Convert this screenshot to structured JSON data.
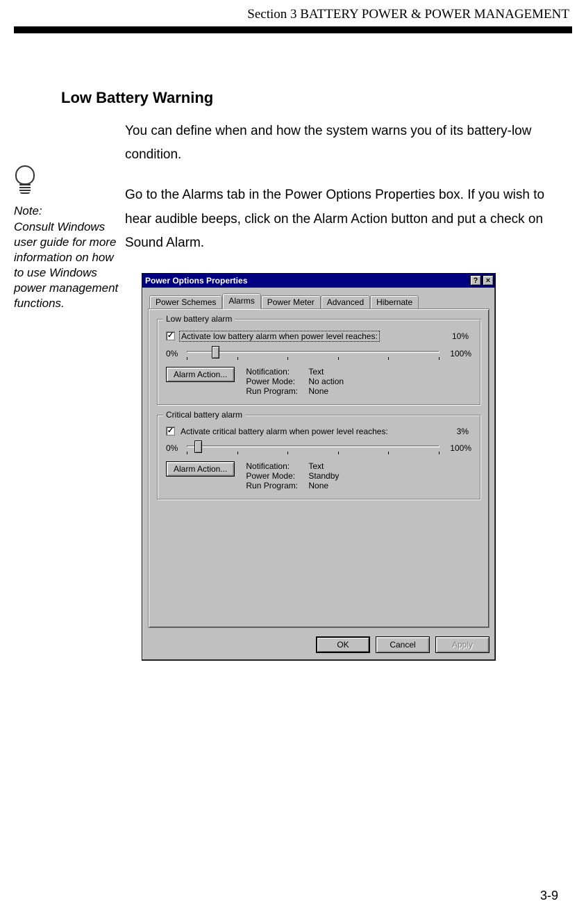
{
  "header": {
    "section_title": "Section 3 BATTERY POWER & POWER MANAGEMENT"
  },
  "sidebar": {
    "note_label": "Note:",
    "note_text": "Consult Windows user guide for more information on how to use Windows power management functions."
  },
  "main": {
    "heading": "Low Battery Warning",
    "para1": "You can define when and how the system warns you of its battery-low condition.",
    "para2": "Go to the Alarms tab in the Power Options Properties box. If you wish to hear audible beeps, click on the Alarm Action button and put a check on Sound Alarm."
  },
  "dialog": {
    "title": "Power Options Properties",
    "help_glyph": "?",
    "close_glyph": "×",
    "tabs": {
      "power_schemes": "Power Schemes",
      "alarms": "Alarms",
      "power_meter": "Power Meter",
      "advanced": "Advanced",
      "hibernate": "Hibernate"
    },
    "low": {
      "legend": "Low battery alarm",
      "check_label": "Activate low battery alarm when power level reaches:",
      "pct": "10%",
      "slider_min": "0%",
      "slider_max": "100%",
      "alarm_action_btn": "Alarm Action...",
      "status": {
        "notif_k": "Notification:",
        "notif_v": "Text",
        "mode_k": "Power Mode:",
        "mode_v": "No action",
        "run_k": "Run Program:",
        "run_v": "None"
      }
    },
    "crit": {
      "legend": "Critical battery alarm",
      "check_label": "Activate critical battery alarm when power level reaches:",
      "pct": "3%",
      "slider_min": "0%",
      "slider_max": "100%",
      "alarm_action_btn": "Alarm Action...",
      "status": {
        "notif_k": "Notification:",
        "notif_v": "Text",
        "mode_k": "Power Mode:",
        "mode_v": "Standby",
        "run_k": "Run Program:",
        "run_v": "None"
      }
    },
    "buttons": {
      "ok": "OK",
      "cancel": "Cancel",
      "apply": "Apply"
    }
  },
  "footer": {
    "page_num": "3-9"
  }
}
